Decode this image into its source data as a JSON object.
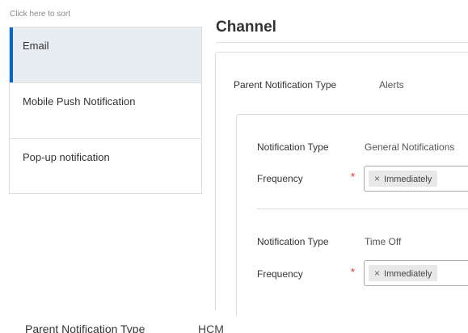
{
  "sort_panel": {
    "hint": "Click here to sort",
    "items": [
      {
        "label": "Email",
        "selected": true
      },
      {
        "label": "Mobile Push Notification",
        "selected": false
      },
      {
        "label": "Pop-up notification",
        "selected": false
      }
    ]
  },
  "channel": {
    "title": "Channel",
    "parent_type_label": "Parent Notification Type",
    "parent_type_value": "Alerts",
    "notifications": [
      {
        "type_label": "Notification Type",
        "type_value": "General Notifications",
        "frequency_label": "Frequency",
        "required_mark": "*",
        "frequency_value": "Immediately",
        "remove_glyph": "×"
      },
      {
        "type_label": "Notification Type",
        "type_value": "Time Off",
        "frequency_label": "Frequency",
        "required_mark": "*",
        "frequency_value": "Immediately",
        "remove_glyph": "×"
      }
    ]
  },
  "next_group": {
    "parent_type_label": "Parent Notification Type",
    "parent_type_value": "HCM"
  },
  "colors": {
    "selected_accent": "#0b65c2",
    "selected_background": "#e8edf2",
    "required": "#de2e21"
  }
}
